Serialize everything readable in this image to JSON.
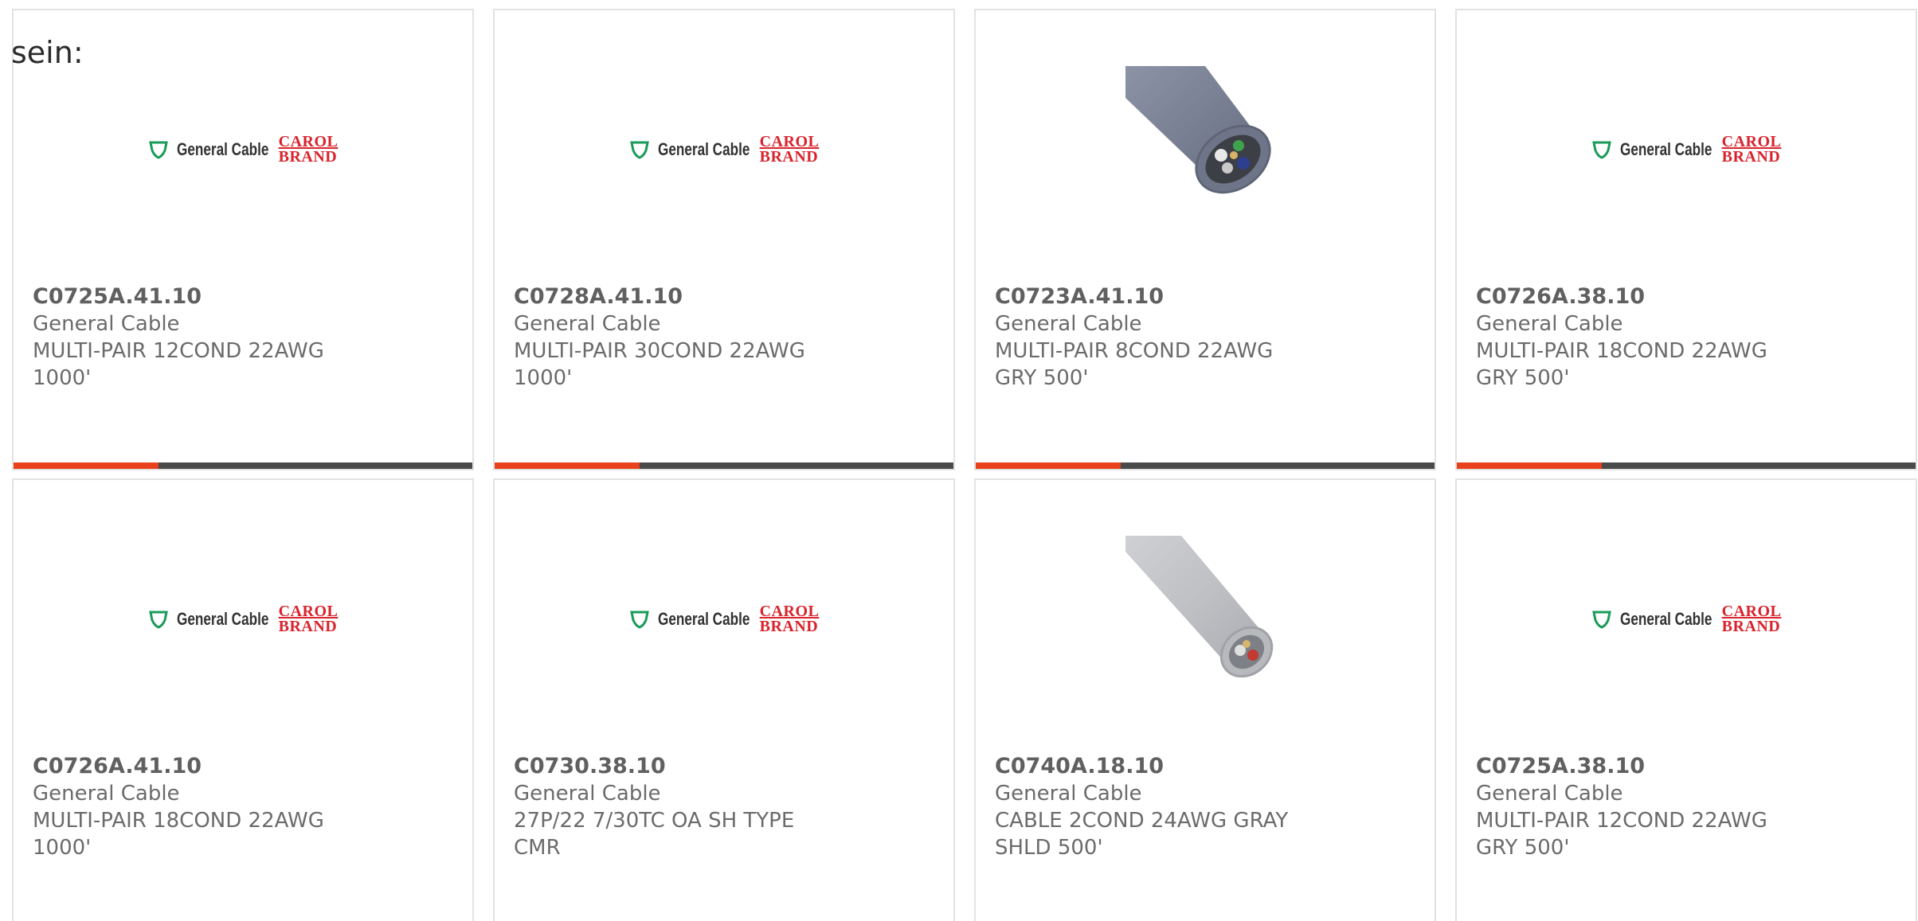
{
  "intro_text": "sein:",
  "products": [
    {
      "part_number": "C0725A.41.10",
      "brand": "General Cable",
      "description": "MULTI-PAIR 12COND 22AWG 1000'",
      "image": "brand-logo"
    },
    {
      "part_number": "C0728A.41.10",
      "brand": "General Cable",
      "description": "MULTI-PAIR 30COND 22AWG 1000'",
      "image": "brand-logo"
    },
    {
      "part_number": "C0723A.41.10",
      "brand": "General Cable",
      "description": "MULTI-PAIR 8COND 22AWG GRY 500'",
      "image": "cable-photo-dark"
    },
    {
      "part_number": "C0726A.38.10",
      "brand": "General Cable",
      "description": "MULTI-PAIR 18COND 22AWG GRY 500'",
      "image": "brand-logo"
    },
    {
      "part_number": "C0726A.41.10",
      "brand": "General Cable",
      "description": "MULTI-PAIR 18COND 22AWG 1000'",
      "image": "brand-logo"
    },
    {
      "part_number": "C0730.38.10",
      "brand": "General Cable",
      "description": "27P/22 7/30TC OA SH TYPE CMR",
      "image": "brand-logo"
    },
    {
      "part_number": "C0740A.18.10",
      "brand": "General Cable",
      "description": "CABLE 2COND 24AWG GRAY SHLD 500'",
      "image": "cable-photo-light"
    },
    {
      "part_number": "C0725A.38.10",
      "brand": "General Cable",
      "description": "MULTI-PAIR 12COND 22AWG GRY 500'",
      "image": "brand-logo"
    }
  ],
  "logo": {
    "general_cable_text": "General Cable",
    "carol_line1": "CAROL",
    "carol_line2": "BRAND"
  },
  "colors": {
    "accent": "#e8411b",
    "bar": "#4a4a4a",
    "carol_red": "#d9232c",
    "shield_green": "#1a9b5a"
  }
}
